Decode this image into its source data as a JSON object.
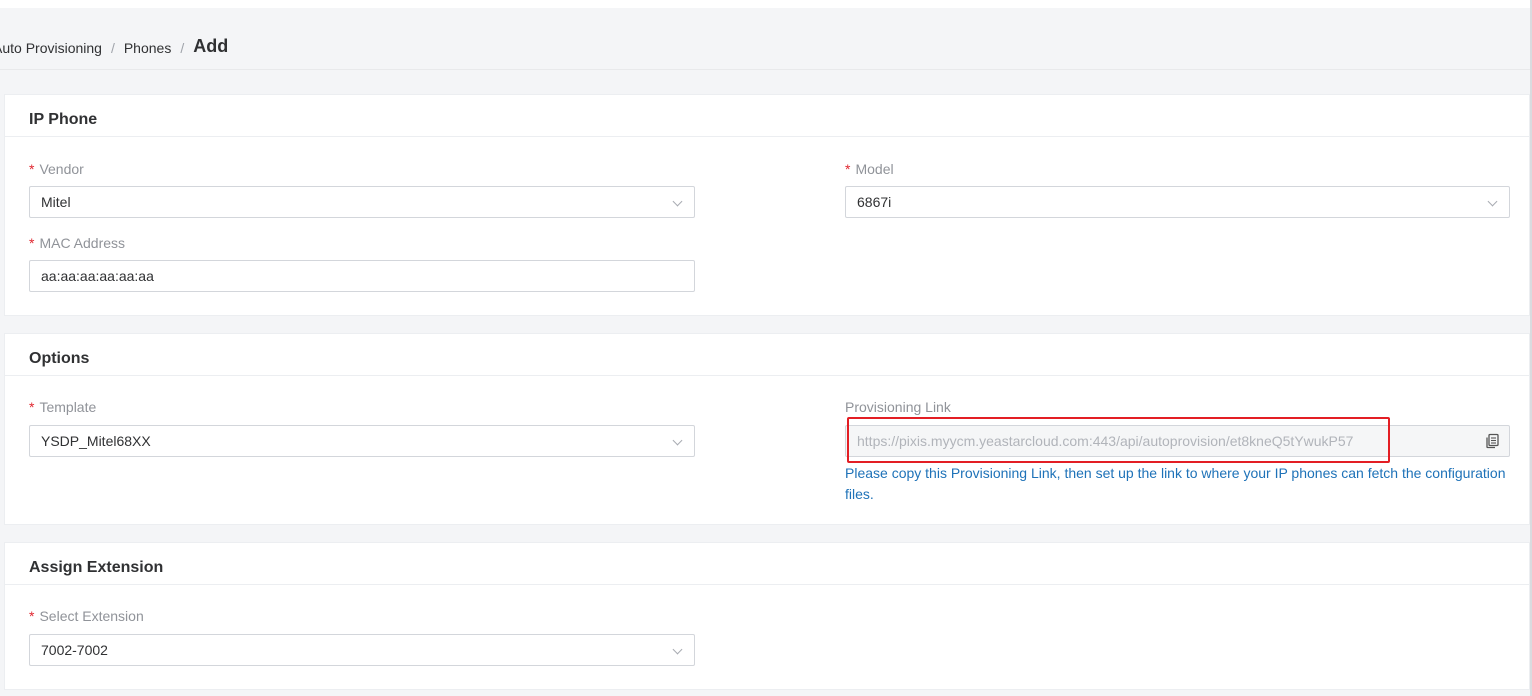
{
  "breadcrumb": {
    "items": [
      "Auto Provisioning",
      "Phones"
    ],
    "current": "Add",
    "separator": "/"
  },
  "ip_phone": {
    "title": "IP Phone",
    "vendor": {
      "label": "Vendor",
      "value": "Mitel"
    },
    "model": {
      "label": "Model",
      "value": "6867i"
    },
    "mac": {
      "label": "MAC Address",
      "value": "aa:aa:aa:aa:aa:aa"
    }
  },
  "options": {
    "title": "Options",
    "template": {
      "label": "Template",
      "value": "YSDP_Mitel68XX"
    },
    "provisioning_link": {
      "label": "Provisioning Link",
      "value": "https://pixis.myycm.yeastarcloud.com:443/api/autoprovision/et8kneQ5tYwukP57",
      "help": "Please copy this Provisioning Link, then set up the link to where your IP phones can fetch the configuration files."
    }
  },
  "assign_extension": {
    "title": "Assign Extension",
    "extension": {
      "label": "Select Extension",
      "value": "7002-7002"
    }
  },
  "required_marker": "*",
  "colors": {
    "required": "#e0262f",
    "help_text": "#1e72b8",
    "highlight_box": "#e31e24"
  }
}
